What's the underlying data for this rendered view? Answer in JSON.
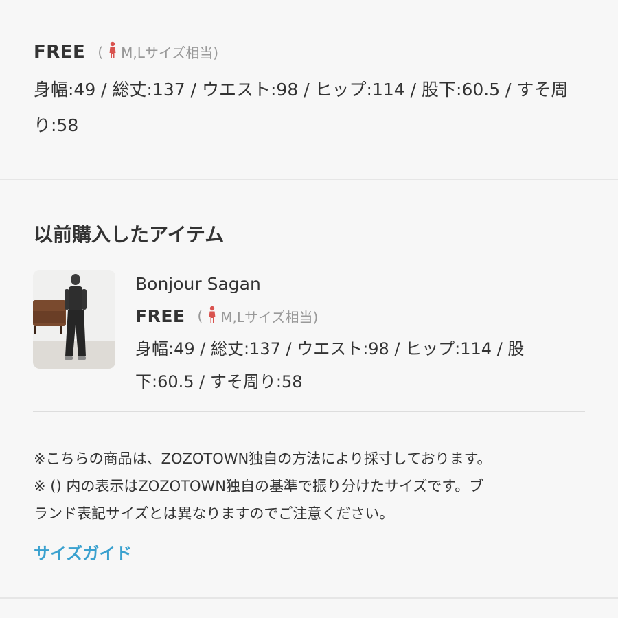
{
  "top": {
    "size_name": "FREE",
    "equiv_open": "(",
    "equiv_text": "M,Lサイズ相当)",
    "measurements": "身幅:49 / 総丈:137 / ウエスト:98 / ヒップ:114 / 股下:60.5 / すそ周り:58"
  },
  "purchased": {
    "title": "以前購入したアイテム",
    "item": {
      "brand": "Bonjour Sagan",
      "size_name": "FREE",
      "equiv_open": "(",
      "equiv_text": "M,Lサイズ相当)",
      "measurements": "身幅:49 / 総丈:137 / ウエスト:98 / ヒップ:114 / 股下:60.5 / すそ周り:58"
    }
  },
  "notes": [
    "※こちらの商品は、ZOZOTOWN独自の方法により採寸しております。",
    "※ () 内の表示はZOZOTOWN独自の基準で振り分けたサイズです。ブ",
    "ランド表記サイズとは異なりますのでご注意ください。"
  ],
  "size_guide_label": "サイズガイド",
  "icons": {
    "equiv_icon": "person-icon"
  },
  "colors": {
    "background": "#f7f7f7",
    "text": "#333333",
    "muted": "#999999",
    "person_icon": "#d9534f",
    "link": "#3aa1cf"
  }
}
